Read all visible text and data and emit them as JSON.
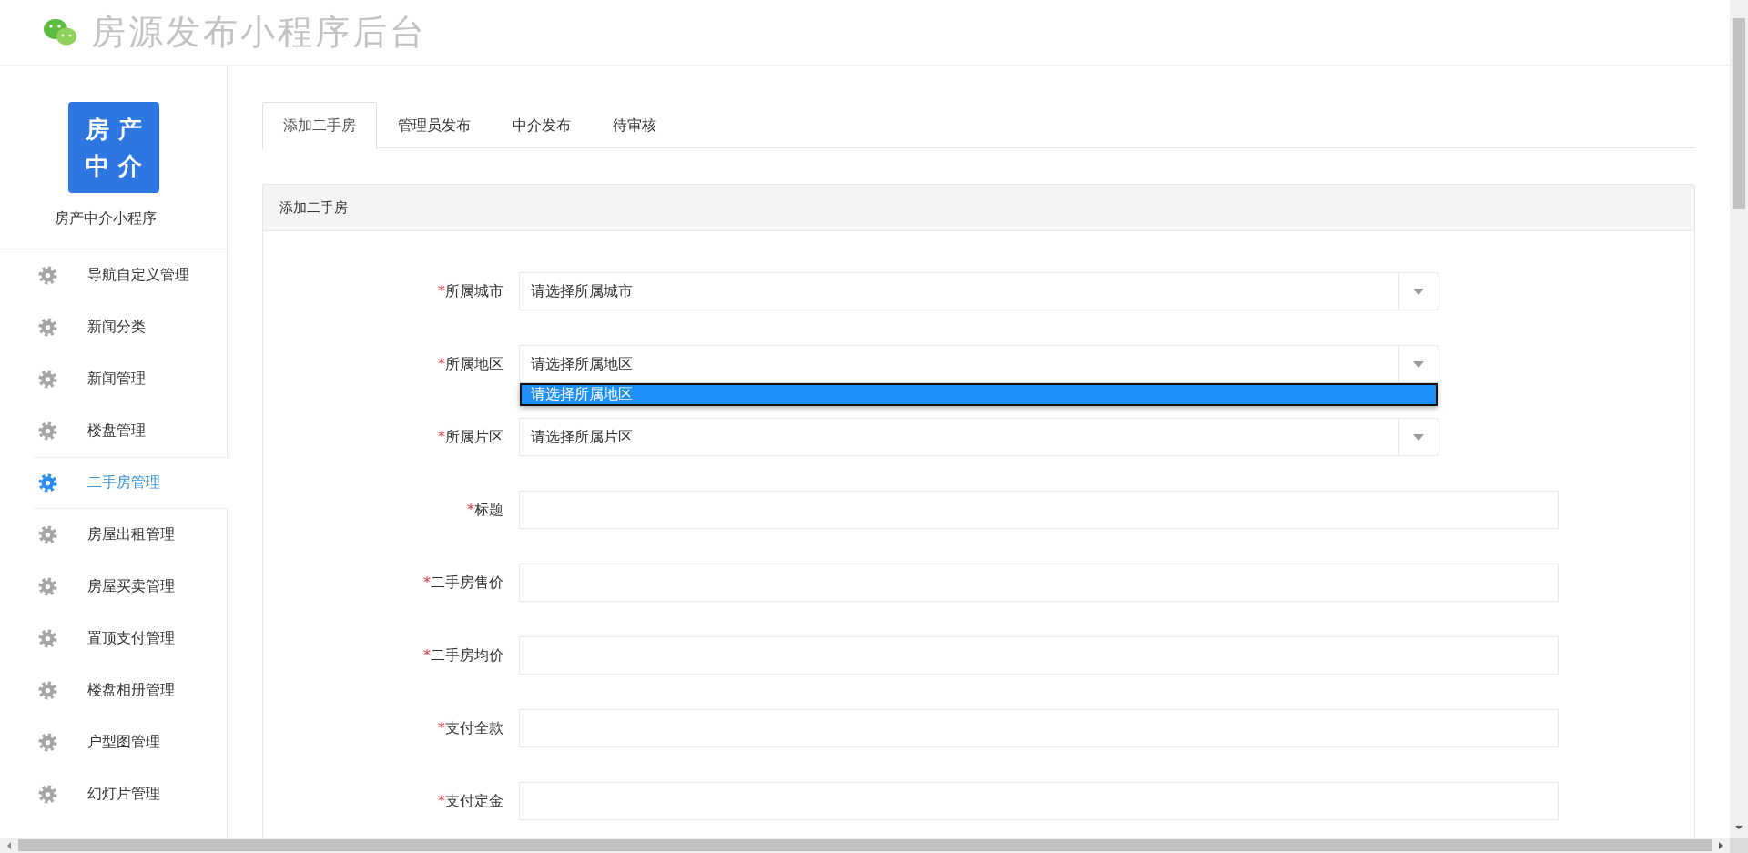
{
  "header": {
    "title": "房源发布小程序后台"
  },
  "sidebar": {
    "logo": {
      "characters": [
        "房",
        "产",
        "中",
        "介"
      ]
    },
    "caption": "房产中介小程序",
    "items": [
      {
        "label": "导航自定义管理",
        "selected": false
      },
      {
        "label": "新闻分类",
        "selected": false
      },
      {
        "label": "新闻管理",
        "selected": false
      },
      {
        "label": "楼盘管理",
        "selected": false
      },
      {
        "label": "二手房管理",
        "selected": true
      },
      {
        "label": "房屋出租管理",
        "selected": false
      },
      {
        "label": "房屋买卖管理",
        "selected": false
      },
      {
        "label": "置顶支付管理",
        "selected": false
      },
      {
        "label": "楼盘相册管理",
        "selected": false
      },
      {
        "label": "户型图管理",
        "selected": false
      },
      {
        "label": "幻灯片管理",
        "selected": false
      }
    ]
  },
  "tabs": [
    {
      "label": "添加二手房",
      "selected": true
    },
    {
      "label": "管理员发布",
      "selected": false
    },
    {
      "label": "中介发布",
      "selected": false
    },
    {
      "label": "待审核",
      "selected": false
    }
  ],
  "panel": {
    "title": "添加二手房",
    "fields": [
      {
        "kind": "select",
        "marker": "*",
        "label": "所属城市",
        "value": "请选择所属城市"
      },
      {
        "kind": "select",
        "marker": "*",
        "label": "所属地区",
        "value": "请选择所属地区",
        "options": [
          {
            "label": "请选择所属地区",
            "selected": true
          }
        ]
      },
      {
        "kind": "select",
        "marker": "*",
        "label": "所属片区",
        "value": "请选择所属片区"
      },
      {
        "kind": "text",
        "marker": "*",
        "label": "标题"
      },
      {
        "kind": "text",
        "marker": "*",
        "label": "二手房售价"
      },
      {
        "kind": "text",
        "marker": "*",
        "label": "二手房均价"
      },
      {
        "kind": "text",
        "marker": "*",
        "label": "支付全款"
      },
      {
        "kind": "text",
        "marker": "*",
        "label": "支付定金"
      }
    ]
  }
}
